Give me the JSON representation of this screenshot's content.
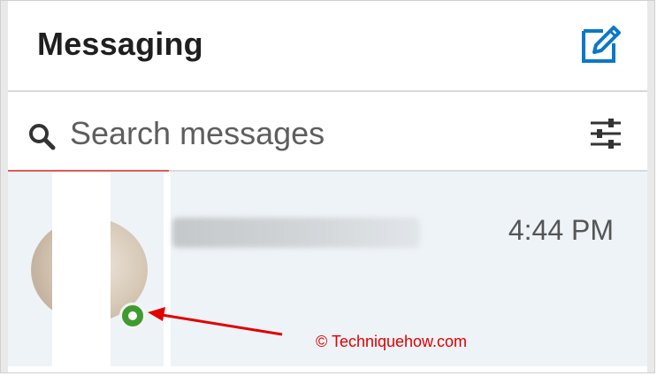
{
  "header": {
    "title": "Messaging",
    "compose_icon": "compose-edit-icon",
    "accent_color": "#0a78c8"
  },
  "search": {
    "placeholder": "Search messages",
    "search_icon": "search-icon",
    "filter_icon": "filter-sliders-icon"
  },
  "conversation": {
    "time": "4:44 PM",
    "online_status_color": "#3f9b2f"
  },
  "annotation": {
    "watermark": "© Techniquehow.com",
    "arrow_color": "#e00000"
  }
}
